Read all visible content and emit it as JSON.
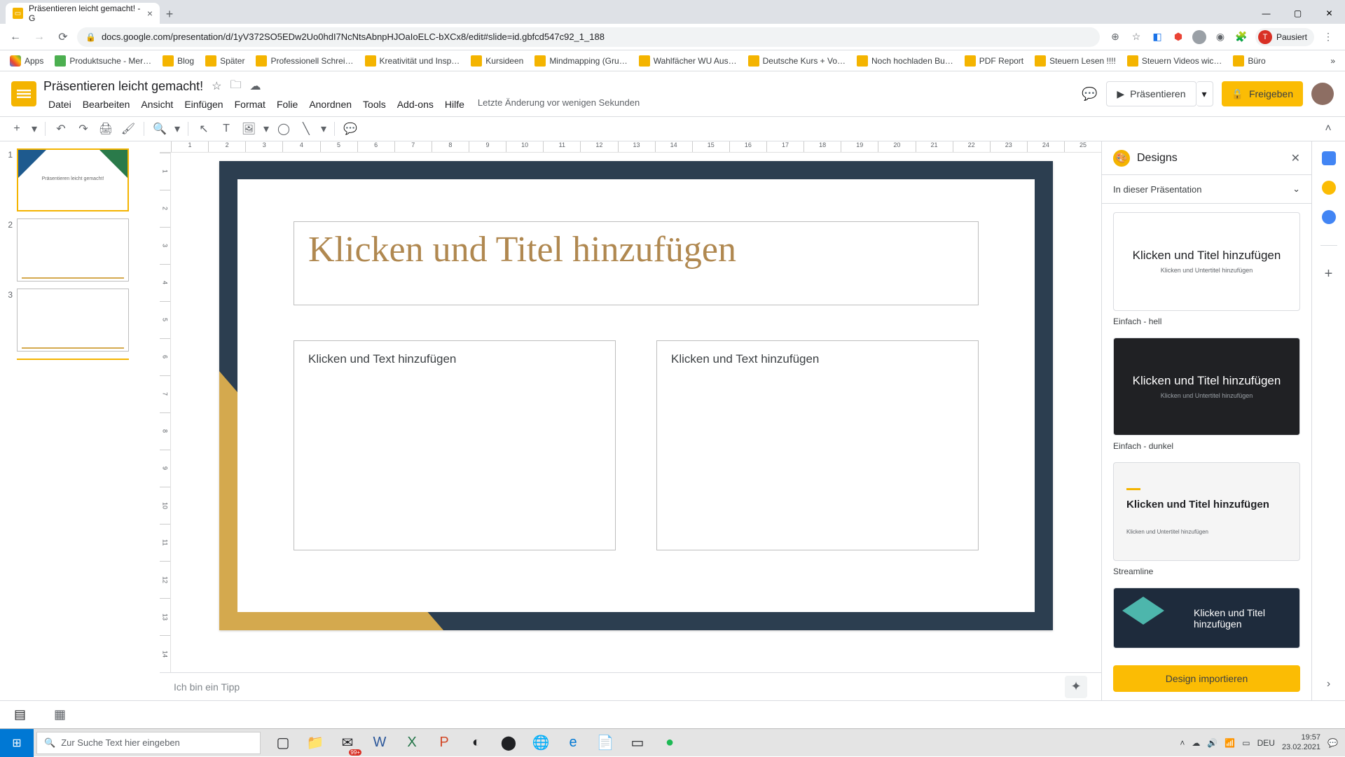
{
  "browser": {
    "tab_title": "Präsentieren leicht gemacht! - G",
    "url": "docs.google.com/presentation/d/1yV372SO5EDw2Uo0hdI7NcNtsAbnpHJOaIoELC-bXCx8/edit#slide=id.gbfcd547c92_1_188",
    "profile_state": "Pausiert",
    "profile_initial": "T"
  },
  "bookmarks": [
    "Apps",
    "Produktsuche - Mer…",
    "Blog",
    "Später",
    "Professionell Schrei…",
    "Kreativität und Insp…",
    "Kursideen",
    "Mindmapping  (Gru…",
    "Wahlfächer WU Aus…",
    "Deutsche Kurs + Vo…",
    "Noch hochladen Bu…",
    "PDF Report",
    "Steuern Lesen !!!!",
    "Steuern Videos wic…",
    "Büro"
  ],
  "doc": {
    "title": "Präsentieren leicht gemacht!",
    "last_edit": "Letzte Änderung vor wenigen Sekunden"
  },
  "menu": {
    "file": "Datei",
    "edit": "Bearbeiten",
    "view": "Ansicht",
    "insert": "Einfügen",
    "format": "Format",
    "slide": "Folie",
    "arrange": "Anordnen",
    "tools": "Tools",
    "addons": "Add-ons",
    "help": "Hilfe"
  },
  "header": {
    "present": "Präsentieren",
    "share": "Freigeben"
  },
  "ruler_h": [
    "1",
    "2",
    "3",
    "4",
    "5",
    "6",
    "7",
    "8",
    "9",
    "10",
    "11",
    "12",
    "13",
    "14",
    "15",
    "16",
    "17",
    "18",
    "19",
    "20",
    "21",
    "22",
    "23",
    "24",
    "25"
  ],
  "ruler_v": [
    "1",
    "2",
    "3",
    "4",
    "5",
    "6",
    "7",
    "8",
    "9",
    "10",
    "11",
    "12",
    "13",
    "14"
  ],
  "slide": {
    "title_placeholder": "Klicken und Titel hinzufügen",
    "text_placeholder": "Klicken und Text hinzufügen"
  },
  "thumbs": {
    "n1": "1",
    "n2": "2",
    "n3": "3",
    "t1_text": "Präsentieren leicht gemacht!"
  },
  "notes": {
    "placeholder": "Ich bin ein Tipp"
  },
  "designs": {
    "title": "Designs",
    "section": "In dieser Präsentation",
    "thumb_title": "Klicken und Titel hinzufügen",
    "thumb_sub": "Klicken und Untertitel hinzufügen",
    "label_light": "Einfach - hell",
    "label_dark": "Einfach - dunkel",
    "label_stream": "Streamline",
    "import": "Design importieren"
  },
  "taskbar": {
    "search_placeholder": "Zur Suche Text hier eingeben",
    "lang": "DEU",
    "time": "19:57",
    "date": "23.02.2021",
    "tray_badge": "99+"
  }
}
